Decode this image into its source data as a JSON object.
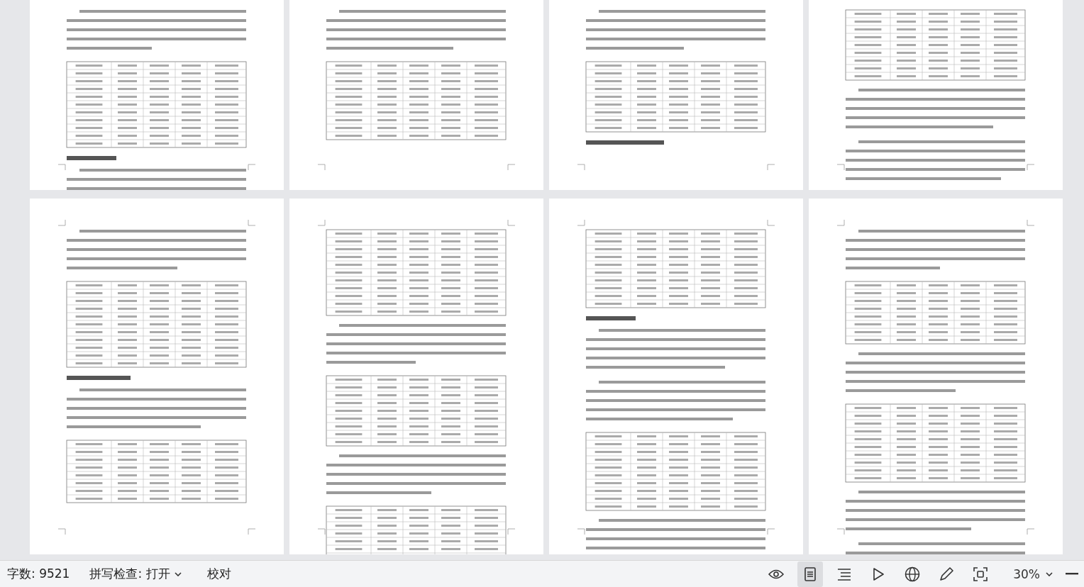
{
  "status_bar": {
    "word_count": "字数: 9521",
    "spell_check": "拼写检查: 打开",
    "proofread": "校对",
    "view_buttons": [
      {
        "kind": "read",
        "selected": false
      },
      {
        "kind": "page",
        "selected": true
      },
      {
        "kind": "outline",
        "selected": false
      },
      {
        "kind": "play",
        "selected": false
      },
      {
        "kind": "web",
        "selected": false
      },
      {
        "kind": "pen",
        "selected": false
      },
      {
        "kind": "fit",
        "selected": false
      }
    ],
    "zoom": "30%"
  }
}
